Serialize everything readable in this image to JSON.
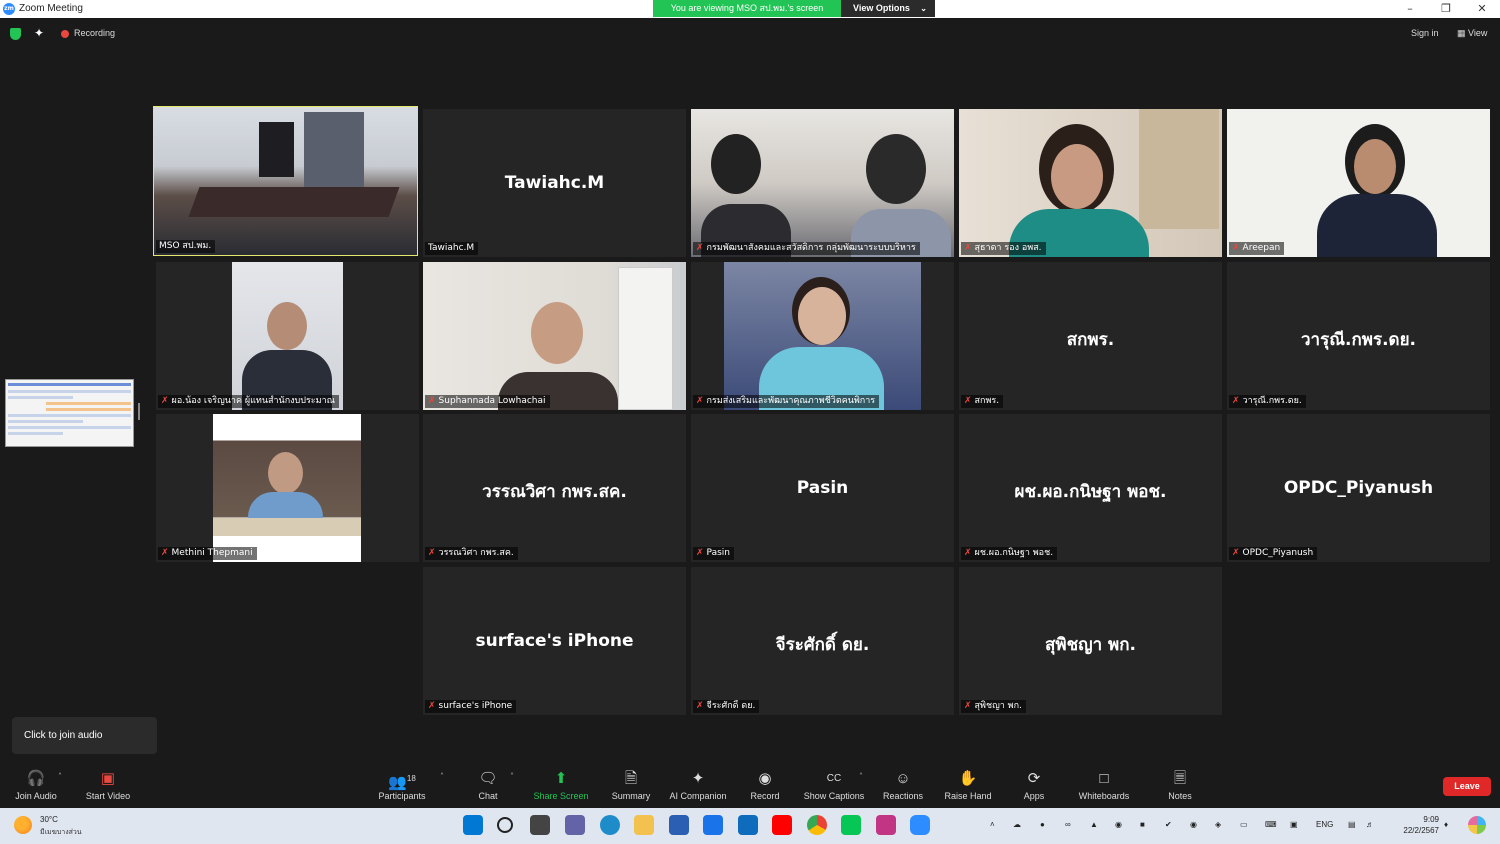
{
  "window": {
    "title": "Zoom Meeting",
    "app_icon_text": "zm",
    "viewing_banner": "You are viewing MSO สป.พม.'s screen",
    "view_options": "View Options"
  },
  "topbar": {
    "recording": "Recording",
    "sign_in": "Sign in",
    "view": "View"
  },
  "tiles": [
    {
      "label": "MSO สป.พม.",
      "big": ""
    },
    {
      "label": "Tawiahc.M",
      "big": "Tawiahc.M"
    },
    {
      "label": "กรมพัฒนาสังคมและสวัสดิการ กลุ่มพัฒนาระบบบริหาร",
      "big": ""
    },
    {
      "label": "สุธาดา รอง อพส.",
      "big": ""
    },
    {
      "label": "Areepan",
      "big": ""
    },
    {
      "label": "ผอ.น้อง เจริญนาค ผู้แทนสำนักงบประมาณ",
      "big": ""
    },
    {
      "label": "Suphannada Lowhachai",
      "big": ""
    },
    {
      "label": "กรมส่งเสริมและพัฒนาคุณภาพชีวิตคนพิการ",
      "big": ""
    },
    {
      "label": "สกพร.",
      "big": "สกพร."
    },
    {
      "label": "วารุณี.กพร.ดย.",
      "big": "วารุณี.กพร.ดย."
    },
    {
      "label": "Methini Thepmani",
      "big": ""
    },
    {
      "label": "วรรณวิศา กพร.สค.",
      "big": "วรรณวิศา กพร.สค."
    },
    {
      "label": "Pasin",
      "big": "Pasin"
    },
    {
      "label": "ผช.ผอ.กนิษฐา พอช.",
      "big": "ผช.ผอ.กนิษฐา พอช."
    },
    {
      "label": "OPDC_Piyanush",
      "big": "OPDC_Piyanush"
    },
    {
      "label": "surface's iPhone",
      "big": "surface's iPhone"
    },
    {
      "label": "จีระศักดิ์ ดย.",
      "big": "จีระศักดิ์ ดย."
    },
    {
      "label": "สุพิชญา พก.",
      "big": "สุพิชญา พก."
    }
  ],
  "tooltip": "Click to join audio",
  "toolbar": {
    "join_audio": "Join Audio",
    "start_video": "Start Video",
    "participants": "Participants",
    "participants_count": "18",
    "chat": "Chat",
    "share_screen": "Share Screen",
    "summary": "Summary",
    "ai_companion": "AI Companion",
    "record": "Record",
    "show_captions": "Show Captions",
    "captions_icon_text": "CC",
    "reactions": "Reactions",
    "raise_hand": "Raise Hand",
    "apps": "Apps",
    "whiteboards": "Whiteboards",
    "notes": "Notes",
    "leave": "Leave"
  },
  "taskbar": {
    "temperature": "30°C",
    "weather": "มีเมฆบางส่วน",
    "language": "ENG",
    "time": "9:09",
    "date": "22/2/2567"
  },
  "colors": {
    "active_speaker": "#e5e86b",
    "share_green": "#23c456",
    "leave_red": "#e02828",
    "muted_red": "#e8483f"
  }
}
